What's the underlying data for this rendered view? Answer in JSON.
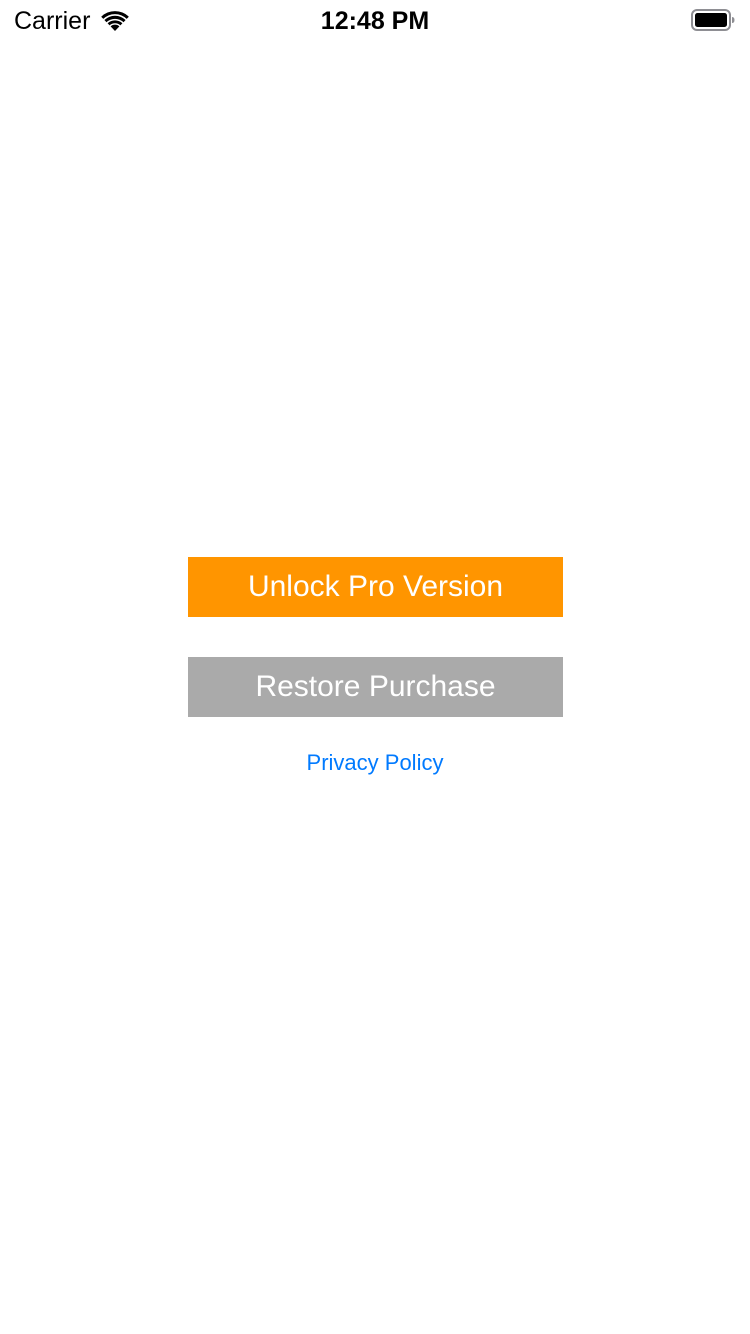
{
  "status_bar": {
    "carrier": "Carrier",
    "time": "12:48 PM",
    "wifi_icon": "wifi-icon",
    "battery_icon": "battery-icon"
  },
  "main": {
    "unlock_label": "Unlock Pro Version",
    "restore_label": "Restore Purchase",
    "privacy_label": "Privacy Policy"
  },
  "colors": {
    "unlock_button": "#ff9500",
    "restore_button": "#aaaaaa",
    "link": "#007aff",
    "background": "#ffffff"
  }
}
